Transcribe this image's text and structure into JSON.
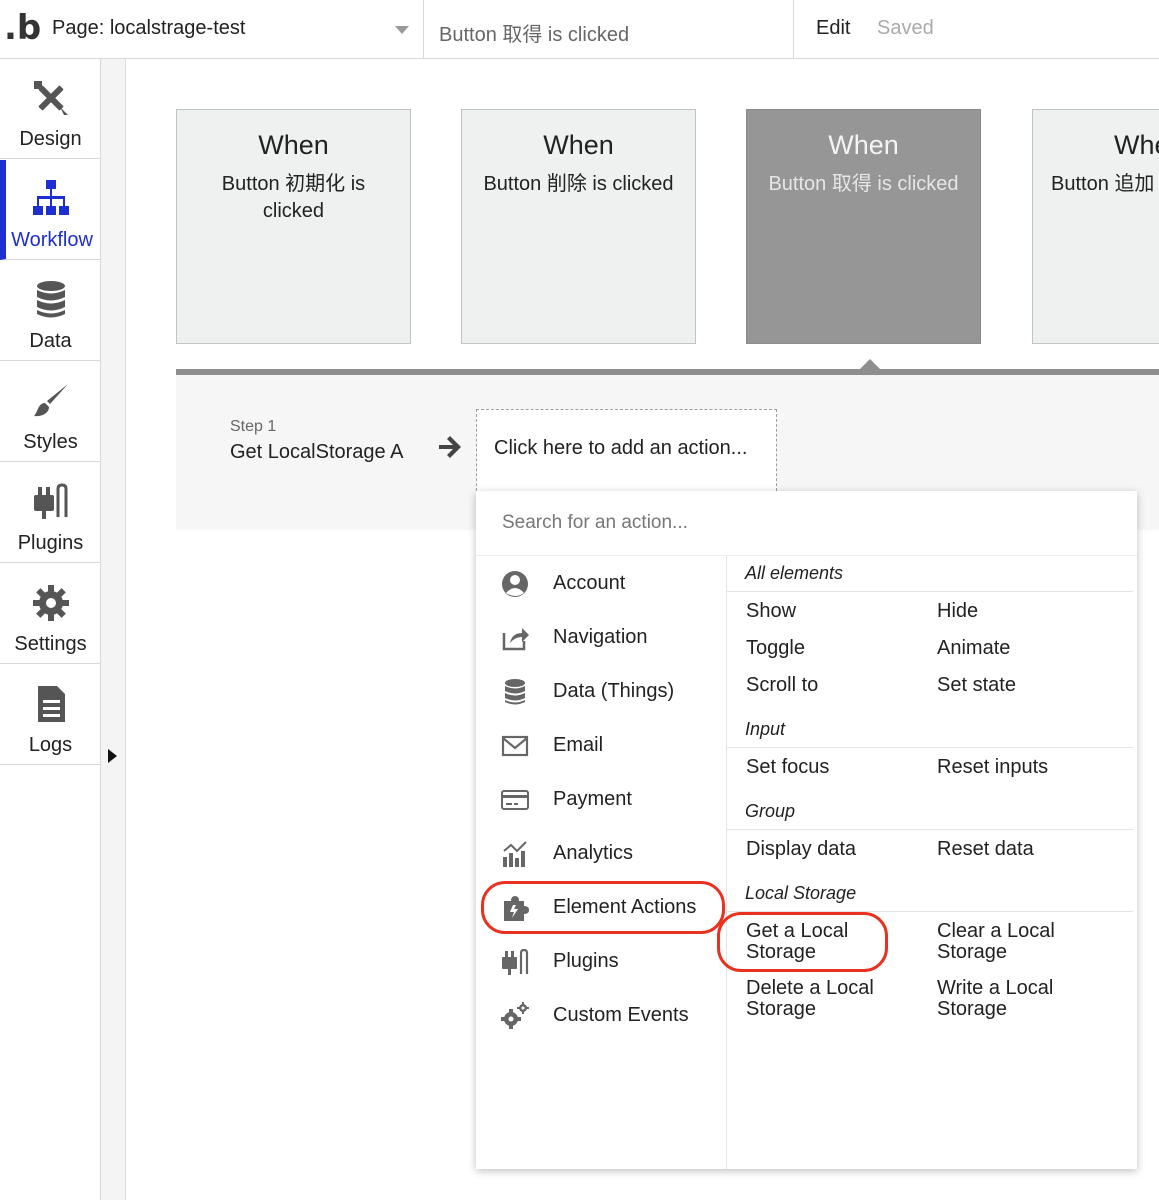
{
  "topbar": {
    "logo": ".b",
    "page_label": "Page: localstrage-test",
    "event_title": "Button 取得 is clicked",
    "edit": "Edit",
    "saved": "Saved"
  },
  "sidebar": {
    "items": [
      {
        "label": "Design",
        "icon": "design-icon"
      },
      {
        "label": "Workflow",
        "icon": "workflow-icon",
        "active": true
      },
      {
        "label": "Data",
        "icon": "database-icon"
      },
      {
        "label": "Styles",
        "icon": "brush-icon"
      },
      {
        "label": "Plugins",
        "icon": "plug-icon"
      },
      {
        "label": "Settings",
        "icon": "gear-icon"
      },
      {
        "label": "Logs",
        "icon": "document-icon"
      }
    ]
  },
  "events": [
    {
      "when": "When",
      "desc": "Button 初期化 is clicked"
    },
    {
      "when": "When",
      "desc": "Button 削除 is clicked"
    },
    {
      "when": "When",
      "desc": "Button 取得 is clicked",
      "selected": true
    },
    {
      "when": "When",
      "desc": "Button 追加 is clicked"
    }
  ],
  "steps": {
    "step_num": "Step 1",
    "step_title": "Get LocalStorage A",
    "add_action": "Click here to add an action..."
  },
  "dropdown": {
    "search_placeholder": "Search for an action...",
    "categories": [
      {
        "label": "Account",
        "icon": "account-icon"
      },
      {
        "label": "Navigation",
        "icon": "navigation-icon"
      },
      {
        "label": "Data (Things)",
        "icon": "database-icon"
      },
      {
        "label": "Email",
        "icon": "email-icon"
      },
      {
        "label": "Payment",
        "icon": "credit-card-icon"
      },
      {
        "label": "Analytics",
        "icon": "analytics-icon"
      },
      {
        "label": "Element Actions",
        "icon": "puzzle-icon",
        "highlighted": true
      },
      {
        "label": "Plugins",
        "icon": "plug-icon"
      },
      {
        "label": "Custom Events",
        "icon": "gears-icon"
      }
    ],
    "sections": {
      "all_elements": {
        "title": "All elements",
        "actions": [
          "Show",
          "Hide",
          "Toggle",
          "Animate",
          "Scroll to",
          "Set state"
        ]
      },
      "input": {
        "title": "Input",
        "actions": [
          "Set focus",
          "Reset inputs"
        ]
      },
      "group": {
        "title": "Group",
        "actions": [
          "Display data",
          "Reset data"
        ]
      },
      "local_storage": {
        "title": "Local Storage",
        "actions": [
          "Get a Local Storage",
          "Clear a Local Storage",
          "Delete a Local Storage",
          "Write a Local Storage"
        ]
      }
    }
  },
  "colors": {
    "accent": "#1d2fd1",
    "highlight": "#e8321f",
    "selected_event": "#969696"
  }
}
